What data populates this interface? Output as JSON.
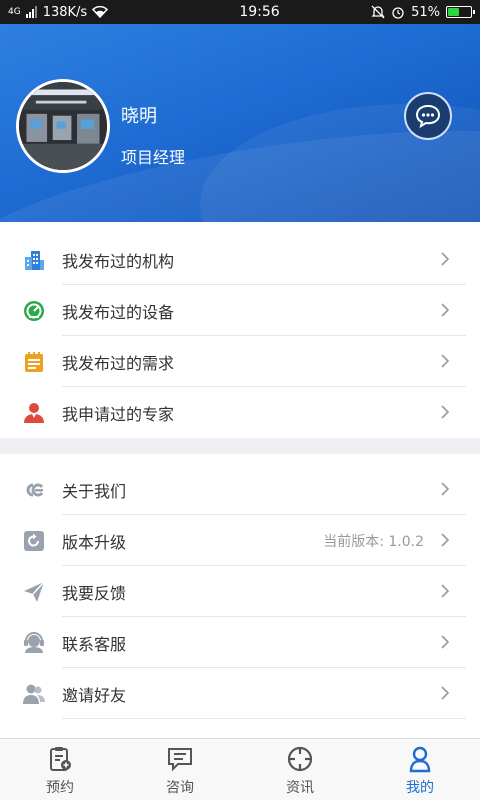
{
  "status_bar": {
    "network_type": "4G",
    "speed": "138K/s",
    "time": "19:56",
    "battery": "51%",
    "battery_level": 0.51
  },
  "profile": {
    "name": "晓明",
    "title": "项目经理"
  },
  "menu_group_1": [
    {
      "label": "我发布过的机构",
      "icon": "building-icon",
      "color": "#2e7fd8"
    },
    {
      "label": "我发布过的设备",
      "icon": "gauge-icon",
      "color": "#2aa84a"
    },
    {
      "label": "我发布过的需求",
      "icon": "notepad-icon",
      "color": "#f0a020"
    },
    {
      "label": "我申请过的专家",
      "icon": "expert-person-icon",
      "color": "#e04a3a"
    }
  ],
  "menu_group_2": [
    {
      "label": "关于我们",
      "icon": "about-icon",
      "extra": ""
    },
    {
      "label": "版本升级",
      "icon": "refresh-icon",
      "extra": "当前版本: 1.0.2"
    },
    {
      "label": "我要反馈",
      "icon": "paper-plane-icon",
      "extra": ""
    },
    {
      "label": "联系客服",
      "icon": "headset-icon",
      "extra": ""
    },
    {
      "label": "邀请好友",
      "icon": "friends-icon",
      "extra": ""
    }
  ],
  "tabs": [
    {
      "label": "预约",
      "icon": "clipboard-icon",
      "active": false
    },
    {
      "label": "咨询",
      "icon": "message-icon",
      "active": false
    },
    {
      "label": "资讯",
      "icon": "compass-icon",
      "active": false
    },
    {
      "label": "我的",
      "icon": "user-icon",
      "active": true
    }
  ],
  "colors": {
    "primary": "#1e6cd3",
    "header_dark": "#0d4fb5",
    "icon_gray": "#9aa3ad"
  }
}
